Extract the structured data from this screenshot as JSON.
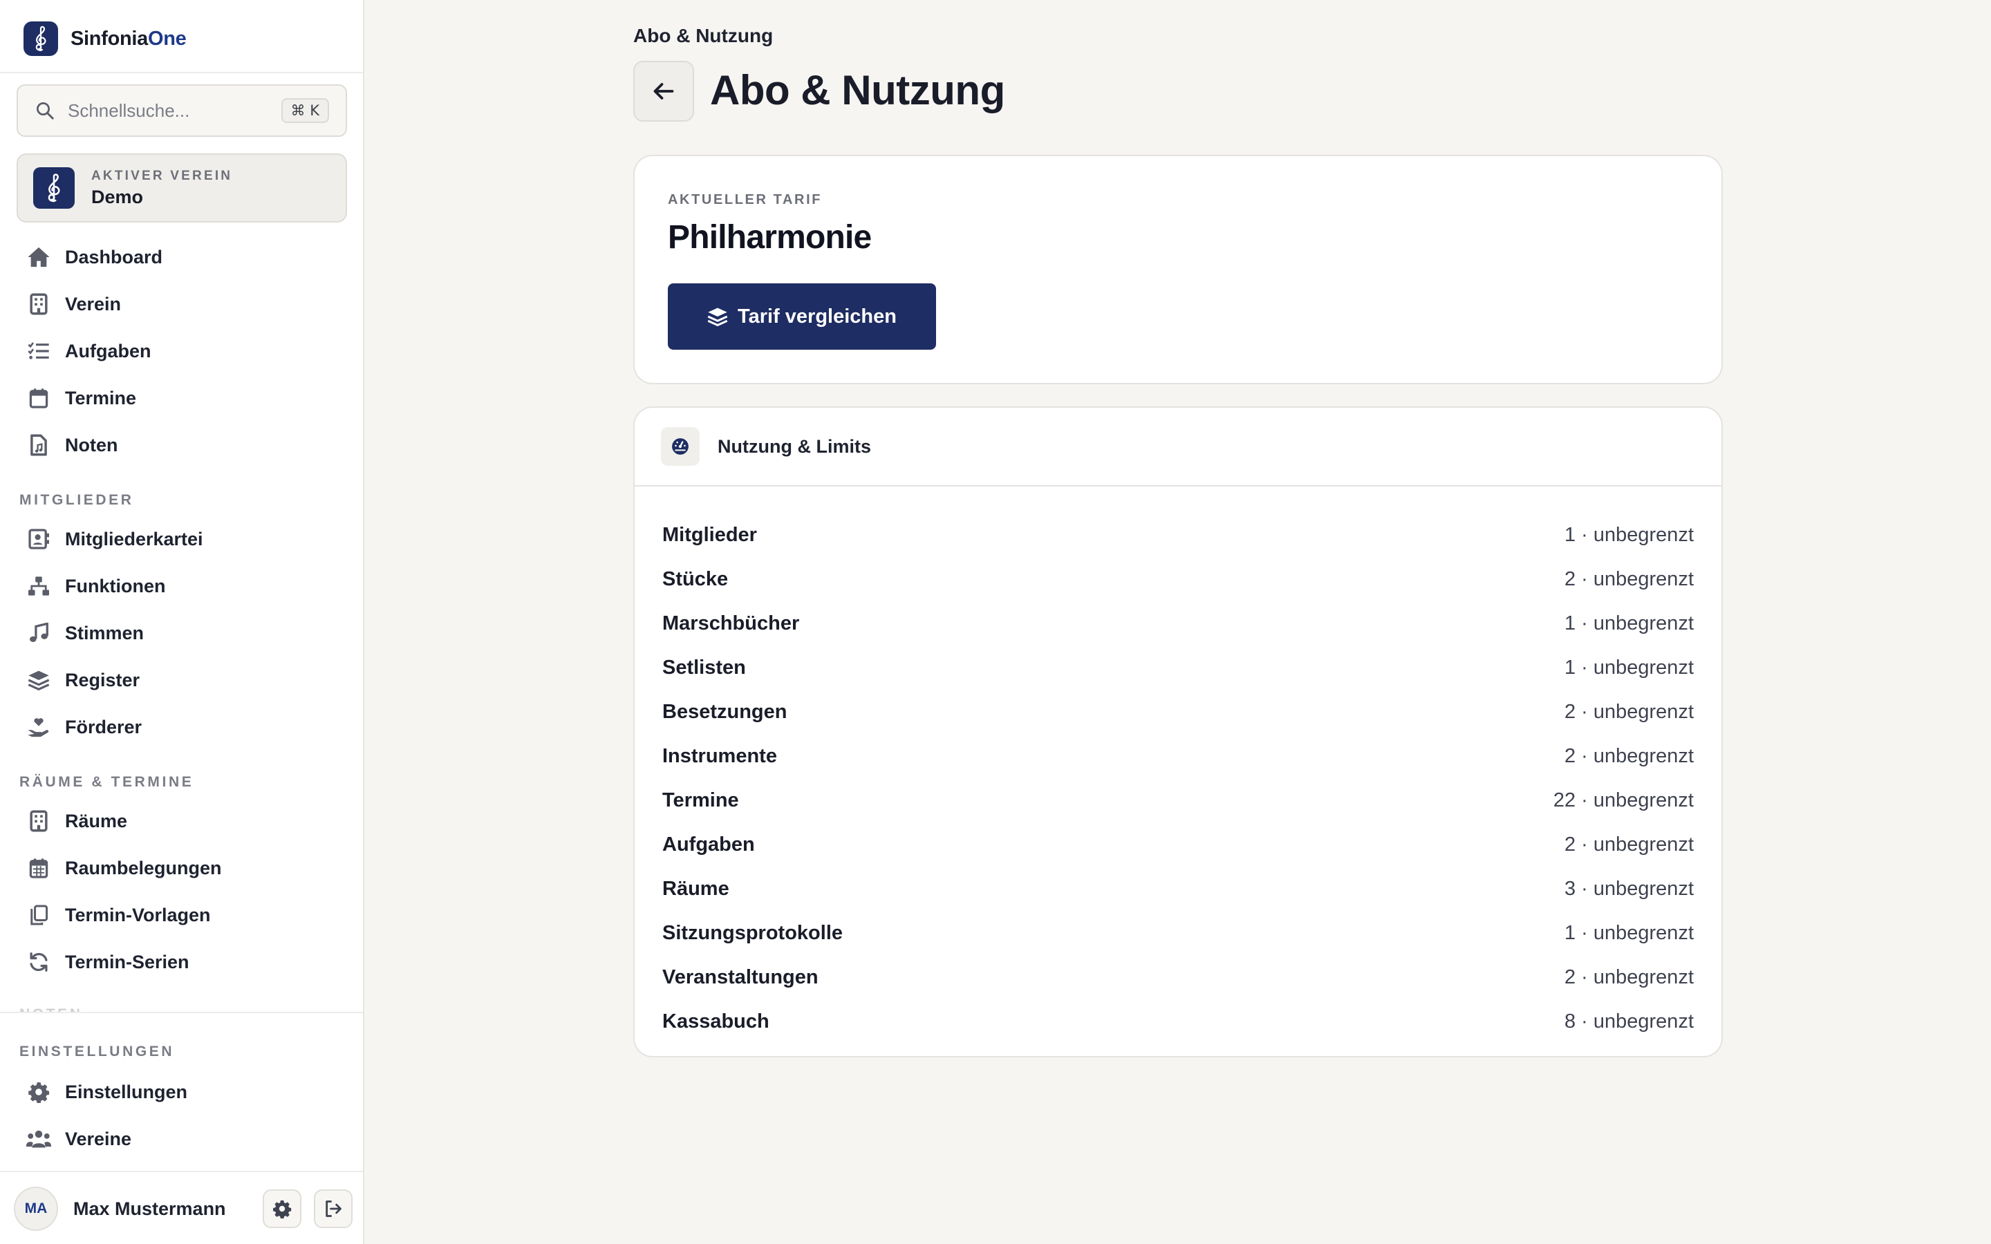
{
  "sidebar": {
    "brand": {
      "name_part1": "Sinfonia",
      "name_part2": "One"
    },
    "search": {
      "placeholder": "Schnellsuche...",
      "shortcut": "⌘ K"
    },
    "active_club": {
      "kicker": "AKTIVER VEREIN",
      "name": "Demo"
    },
    "main_items": [
      {
        "label": "Dashboard",
        "icon": "home-icon"
      },
      {
        "label": "Verein",
        "icon": "building-icon"
      },
      {
        "label": "Aufgaben",
        "icon": "list-check-icon"
      },
      {
        "label": "Termine",
        "icon": "calendar-icon"
      },
      {
        "label": "Noten",
        "icon": "sheet-music-file-icon"
      }
    ],
    "sections": {
      "members": "MITGLIEDER",
      "rooms": "RÄUME & TERMINE",
      "hidden": "NOTEN",
      "settings": "EINSTELLUNGEN"
    },
    "member_items": [
      {
        "label": "Mitgliederkartei",
        "icon": "id-card-icon"
      },
      {
        "label": "Funktionen",
        "icon": "org-chart-icon"
      },
      {
        "label": "Stimmen",
        "icon": "music-note-icon"
      },
      {
        "label": "Register",
        "icon": "layers-icon"
      },
      {
        "label": "Förderer",
        "icon": "hand-heart-icon"
      }
    ],
    "room_items": [
      {
        "label": "Räume",
        "icon": "building-icon"
      },
      {
        "label": "Raumbelegungen",
        "icon": "calendar-grid-icon"
      },
      {
        "label": "Termin-Vorlagen",
        "icon": "copy-icon"
      },
      {
        "label": "Termin-Serien",
        "icon": "refresh-icon"
      }
    ],
    "settings_items": [
      {
        "label": "Einstellungen",
        "icon": "gear-icon"
      },
      {
        "label": "Vereine",
        "icon": "users-icon"
      }
    ],
    "user": {
      "initials": "MA",
      "name": "Max Mustermann"
    }
  },
  "main": {
    "breadcrumb": "Abo & Nutzung",
    "title": "Abo & Nutzung",
    "tariff": {
      "kicker": "AKTUELLER TARIF",
      "name": "Philharmonie",
      "compare_button": "Tarif vergleichen"
    },
    "usage": {
      "title": "Nutzung & Limits",
      "rows": [
        {
          "name": "Mitglieder",
          "value": "1 · unbegrenzt"
        },
        {
          "name": "Stücke",
          "value": "2 · unbegrenzt"
        },
        {
          "name": "Marschbücher",
          "value": "1 · unbegrenzt"
        },
        {
          "name": "Setlisten",
          "value": "1 · unbegrenzt"
        },
        {
          "name": "Besetzungen",
          "value": "2 · unbegrenzt"
        },
        {
          "name": "Instrumente",
          "value": "2 · unbegrenzt"
        },
        {
          "name": "Termine",
          "value": "22 · unbegrenzt"
        },
        {
          "name": "Aufgaben",
          "value": "2 · unbegrenzt"
        },
        {
          "name": "Räume",
          "value": "3 · unbegrenzt"
        },
        {
          "name": "Sitzungsprotokolle",
          "value": "1 · unbegrenzt"
        },
        {
          "name": "Veranstaltungen",
          "value": "2 · unbegrenzt"
        },
        {
          "name": "Kassabuch",
          "value": "8 · unbegrenzt"
        }
      ]
    }
  },
  "colors": {
    "brand_navy": "#1e2d63",
    "accent_blue": "#1e3a8a",
    "page_bg": "#f6f5f2",
    "icon_gray": "#5b5e69"
  }
}
